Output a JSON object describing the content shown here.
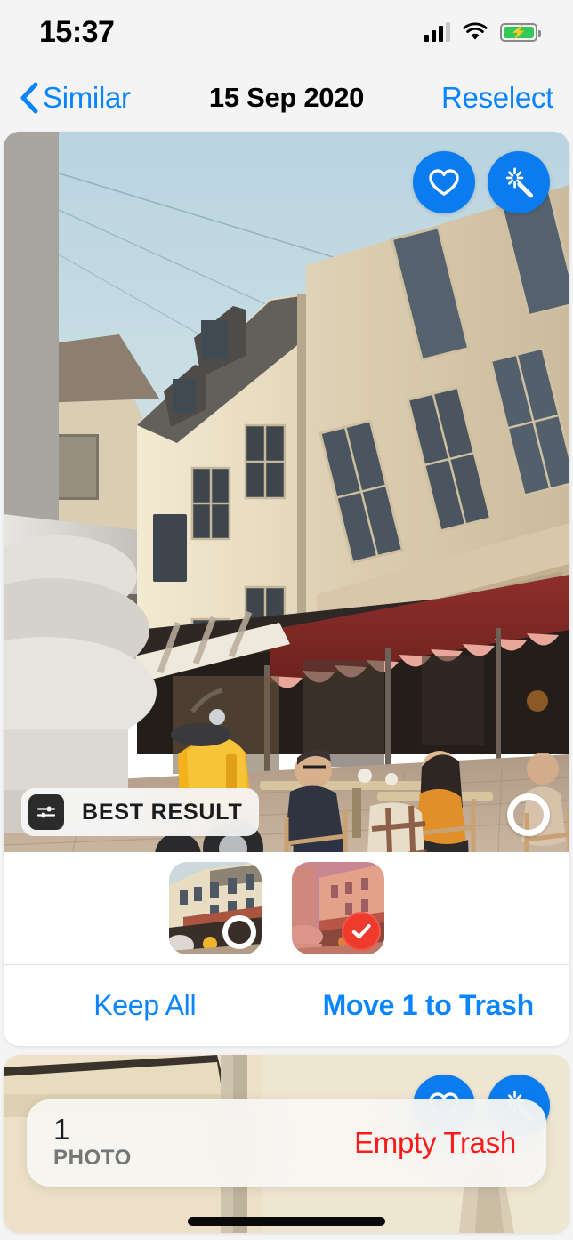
{
  "status_bar": {
    "time": "15:37",
    "cellular_icon": "cellular-bars-icon",
    "wifi_icon": "wifi-icon",
    "battery_icon": "battery-charging-icon",
    "battery_color": "#34c759"
  },
  "nav_bar": {
    "back_icon": "chevron-left-icon",
    "back_label": "Similar",
    "title": "15 Sep 2020",
    "action_label": "Reselect",
    "tint_color": "#0a84ff"
  },
  "main_card": {
    "photo_alt": "Cafe terrace on a cobblestone street with a yellow Vespa scooter, people seated at outdoor tables under a red awning and a white stone monument",
    "actions": [
      {
        "name": "favorite-button",
        "icon": "heart-icon",
        "color": "#0a7cf0"
      },
      {
        "name": "enhance-button",
        "icon": "magic-wand-icon",
        "color": "#0a7cf0"
      }
    ],
    "badge": {
      "icon": "sliders-icon",
      "label": "BEST RESULT"
    },
    "selection": {
      "icon": "circle-unselected-icon",
      "selected": false
    }
  },
  "thumbnails": [
    {
      "name": "thumbnail-1",
      "alt": "Street view with shop awnings and yellow scooter",
      "selected": false,
      "marker_icon": "circle-unselected-icon"
    },
    {
      "name": "thumbnail-2",
      "alt": "Street view with stone column, tinted red to mark for deletion",
      "selected": true,
      "marker_icon": "check-circle-icon",
      "marker_color": "#ef3b2d"
    }
  ],
  "card_buttons": [
    {
      "name": "keep-all-button",
      "label": "Keep All",
      "bold": false
    },
    {
      "name": "move-to-trash-button",
      "label": "Move 1 to Trash",
      "bold": true
    }
  ],
  "next_card": {
    "photo_alt": "Cream building facade with drainpipe, partially visible next photo card",
    "actions": [
      {
        "name": "favorite-button",
        "icon": "heart-icon"
      },
      {
        "name": "enhance-button",
        "icon": "magic-wand-icon"
      }
    ]
  },
  "trash_bar": {
    "count": "1",
    "unit": "PHOTO",
    "action_label": "Empty Trash",
    "action_color": "#ff1a1a"
  },
  "home_indicator": "home-indicator"
}
